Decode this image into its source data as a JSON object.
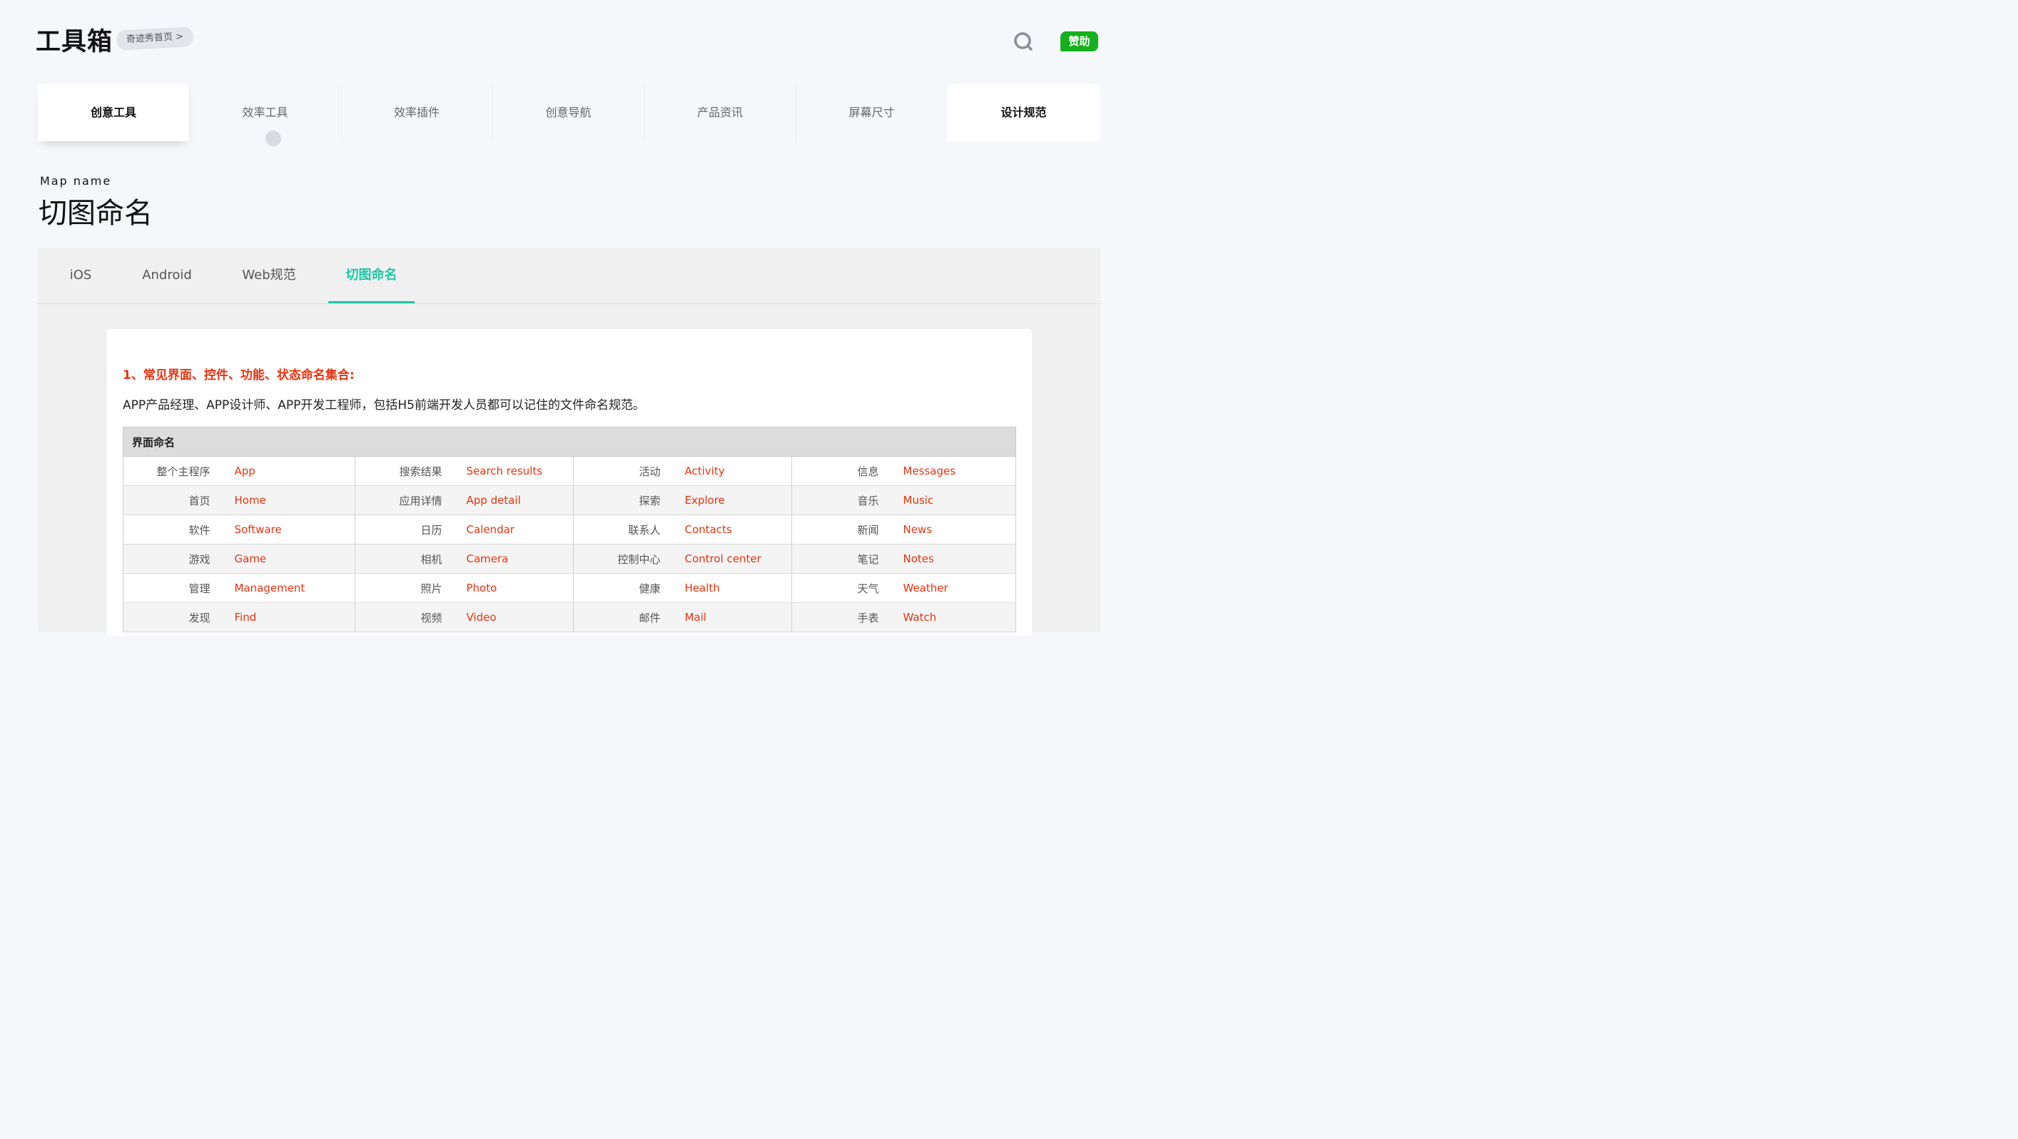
{
  "header": {
    "logo": "工具箱",
    "home_link": "奇迹秀首页 >",
    "sponsor": "赞助"
  },
  "top_tabs": [
    "创意工具",
    "效率工具",
    "效率插件",
    "创意导航",
    "产品资讯",
    "屏幕尺寸",
    "设计规范"
  ],
  "page": {
    "subtitle_en": "Map name",
    "title_cn": "切图命名"
  },
  "sub_tabs": [
    "iOS",
    "Android",
    "Web规范",
    "切图命名"
  ],
  "section": {
    "title": "1、常见界面、控件、功能、状态命名集合:",
    "desc": "APP产品经理、APP设计师、APP开发工程师，包括H5前端开发人员都可以记住的文件命名规范。",
    "table_header": "界面命名",
    "rows": [
      [
        [
          "整个主程序",
          "App"
        ],
        [
          "搜索结果",
          "Search results"
        ],
        [
          "活动",
          "Activity"
        ],
        [
          "信息",
          "Messages"
        ]
      ],
      [
        [
          "首页",
          "Home"
        ],
        [
          "应用详情",
          "App detail"
        ],
        [
          "探索",
          "Explore"
        ],
        [
          "音乐",
          "Music"
        ]
      ],
      [
        [
          "软件",
          "Software"
        ],
        [
          "日历",
          "Calendar"
        ],
        [
          "联系人",
          "Contacts"
        ],
        [
          "新闻",
          "News"
        ]
      ],
      [
        [
          "游戏",
          "Game"
        ],
        [
          "相机",
          "Camera"
        ],
        [
          "控制中心",
          "Control center"
        ],
        [
          "笔记",
          "Notes"
        ]
      ],
      [
        [
          "管理",
          "Management"
        ],
        [
          "照片",
          "Photo"
        ],
        [
          "健康",
          "Health"
        ],
        [
          "天气",
          "Weather"
        ]
      ],
      [
        [
          "发现",
          "Find"
        ],
        [
          "视频",
          "Video"
        ],
        [
          "邮件",
          "Mail"
        ],
        [
          "手表",
          "Watch"
        ]
      ]
    ]
  },
  "colors": {
    "accent_teal": "#1ec7a6",
    "accent_red": "#e8330f",
    "sponsor_green": "#16b01e"
  }
}
